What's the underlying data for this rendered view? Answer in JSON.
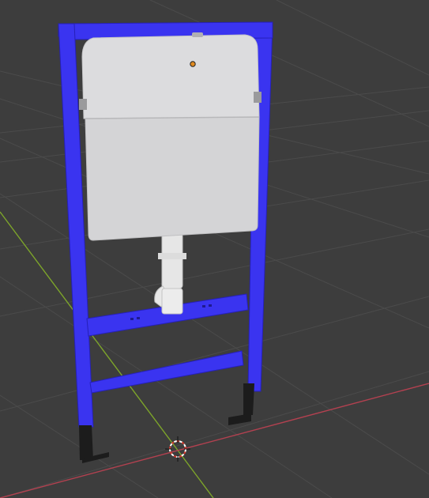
{
  "viewport": {
    "background_color": "#3d3d3d",
    "grid_color": "#4a4a4a",
    "x_axis_color": "#b34150",
    "y_axis_color": "#7da52a"
  },
  "object": {
    "frame_color": "#3a34f0",
    "frame_edge_color": "#2820c8",
    "cistern_color": "#d6d6d8",
    "pipe_color": "#e6e6e6",
    "leg_color": "#1c1c1c",
    "origin_dot_color": "#e08a20"
  },
  "icons": {
    "cursor": "3d-cursor-icon",
    "origin": "object-origin-icon"
  }
}
